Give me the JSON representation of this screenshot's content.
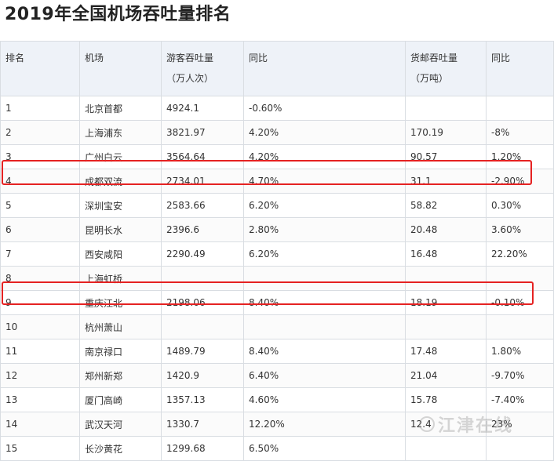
{
  "title": "2019年全国机场吞吐量排名",
  "headers": {
    "rank": "排名",
    "airport": "机场",
    "passenger": [
      "游客吞吐量",
      "（万人次）"
    ],
    "passenger_yoy": "同比",
    "cargo": [
      "货邮吞吐量",
      "（万吨）"
    ],
    "cargo_yoy": "同比"
  },
  "rows": [
    {
      "rank": "1",
      "airport": "北京首都",
      "passenger": "4924.1",
      "passenger_yoy": "-0.60%",
      "cargo": "",
      "cargo_yoy": ""
    },
    {
      "rank": "2",
      "airport": "上海浦东",
      "passenger": "3821.97",
      "passenger_yoy": "4.20%",
      "cargo": "170.19",
      "cargo_yoy": "-8%"
    },
    {
      "rank": "3",
      "airport": "广州白云",
      "passenger": "3564.64",
      "passenger_yoy": "4.20%",
      "cargo": "90.57",
      "cargo_yoy": "1.20%"
    },
    {
      "rank": "4",
      "airport": "成都双流",
      "passenger": "2734.01",
      "passenger_yoy": "4.70%",
      "cargo": "31.1",
      "cargo_yoy": "-2.90%"
    },
    {
      "rank": "5",
      "airport": "深圳宝安",
      "passenger": "2583.66",
      "passenger_yoy": "6.20%",
      "cargo": "58.82",
      "cargo_yoy": "0.30%"
    },
    {
      "rank": "6",
      "airport": "昆明长水",
      "passenger": "2396.6",
      "passenger_yoy": "2.80%",
      "cargo": "20.48",
      "cargo_yoy": "3.60%"
    },
    {
      "rank": "7",
      "airport": "西安咸阳",
      "passenger": "2290.49",
      "passenger_yoy": "6.20%",
      "cargo": "16.48",
      "cargo_yoy": "22.20%"
    },
    {
      "rank": "8",
      "airport": "上海虹桥",
      "passenger": "",
      "passenger_yoy": "",
      "cargo": "",
      "cargo_yoy": ""
    },
    {
      "rank": "9",
      "airport": "重庆江北",
      "passenger": "2198.06",
      "passenger_yoy": "8.40%",
      "cargo": "18.19",
      "cargo_yoy": "-0.10%"
    },
    {
      "rank": "10",
      "airport": "杭州萧山",
      "passenger": "",
      "passenger_yoy": "",
      "cargo": "",
      "cargo_yoy": ""
    },
    {
      "rank": "11",
      "airport": "南京禄口",
      "passenger": "1489.79",
      "passenger_yoy": "8.40%",
      "cargo": "17.48",
      "cargo_yoy": "1.80%"
    },
    {
      "rank": "12",
      "airport": "郑州新郑",
      "passenger": "1420.9",
      "passenger_yoy": "6.40%",
      "cargo": "21.04",
      "cargo_yoy": "-9.70%"
    },
    {
      "rank": "13",
      "airport": "厦门高崎",
      "passenger": "1357.13",
      "passenger_yoy": "4.60%",
      "cargo": "15.78",
      "cargo_yoy": "-7.40%"
    },
    {
      "rank": "14",
      "airport": "武汉天河",
      "passenger": "1330.7",
      "passenger_yoy": "12.20%",
      "cargo": "12.4",
      "cargo_yoy": "23%"
    },
    {
      "rank": "15",
      "airport": "长沙黄花",
      "passenger": "1299.68",
      "passenger_yoy": "6.50%",
      "cargo": "",
      "cargo_yoy": ""
    }
  ],
  "highlighted_ranks": [
    "4",
    "9"
  ],
  "watermark": "江津在线",
  "colors": {
    "highlight_border": "#e52222",
    "header_background": "#eef2f8",
    "grid": "#d9dde2"
  }
}
